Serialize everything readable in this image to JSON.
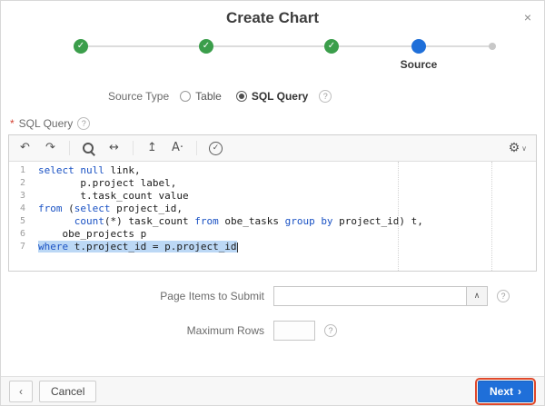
{
  "dialog": {
    "title": "Create Chart",
    "close_glyph": "×"
  },
  "stepper": {
    "check_glyph": "✓",
    "steps": [
      {
        "state": "complete"
      },
      {
        "state": "complete"
      },
      {
        "state": "complete"
      },
      {
        "state": "current",
        "label": "Source"
      },
      {
        "state": "pending"
      }
    ]
  },
  "source_type": {
    "label": "Source Type",
    "options": [
      {
        "label": "Table",
        "selected": false
      },
      {
        "label": "SQL Query",
        "selected": true
      }
    ]
  },
  "sql_editor": {
    "label": "SQL Query",
    "required_marker": "*",
    "toolbar": {
      "icons": [
        {
          "name": "undo-icon",
          "glyph": "↶"
        },
        {
          "name": "redo-icon",
          "glyph": "↷"
        },
        {
          "name": "search-icon",
          "glyph": ""
        },
        {
          "name": "find-replace-icon",
          "glyph": "↔"
        },
        {
          "name": "autocomplete-icon",
          "glyph": "↥"
        },
        {
          "name": "font-size-icon",
          "glyph": "A·"
        },
        {
          "name": "validate-icon",
          "glyph": "✓"
        }
      ],
      "settings_glyph": "⚙",
      "settings_chevron": "∨"
    },
    "lines": [
      {
        "num": 1,
        "selected": false,
        "tokens": [
          {
            "t": "kw",
            "v": "select"
          },
          {
            "t": "pl",
            "v": " "
          },
          {
            "t": "kw",
            "v": "null"
          },
          {
            "t": "pl",
            "v": " link,"
          }
        ]
      },
      {
        "num": 2,
        "selected": false,
        "tokens": [
          {
            "t": "pl",
            "v": "       p.project label,"
          }
        ]
      },
      {
        "num": 3,
        "selected": false,
        "tokens": [
          {
            "t": "pl",
            "v": "       t.task_count value"
          }
        ]
      },
      {
        "num": 4,
        "selected": false,
        "tokens": [
          {
            "t": "kw",
            "v": "from"
          },
          {
            "t": "pl",
            "v": " ("
          },
          {
            "t": "kw",
            "v": "select"
          },
          {
            "t": "pl",
            "v": " project_id,"
          }
        ]
      },
      {
        "num": 5,
        "selected": false,
        "tokens": [
          {
            "t": "pl",
            "v": "      "
          },
          {
            "t": "kw",
            "v": "count"
          },
          {
            "t": "pl",
            "v": "(*) task_count "
          },
          {
            "t": "kw",
            "v": "from"
          },
          {
            "t": "pl",
            "v": " obe_tasks "
          },
          {
            "t": "kw",
            "v": "group by"
          },
          {
            "t": "pl",
            "v": " project_id) t,"
          }
        ]
      },
      {
        "num": 6,
        "selected": false,
        "tokens": [
          {
            "t": "pl",
            "v": "    obe_projects p"
          }
        ]
      },
      {
        "num": 7,
        "selected": true,
        "tokens": [
          {
            "t": "kw",
            "v": "where"
          },
          {
            "t": "pl",
            "v": " t.project_id = p.project_id"
          }
        ]
      }
    ]
  },
  "form": {
    "page_items": {
      "label": "Page Items to Submit",
      "value": "",
      "combo_glyph": "∧"
    },
    "max_rows": {
      "label": "Maximum Rows",
      "value": ""
    }
  },
  "footer": {
    "prev_glyph": "‹",
    "cancel_label": "Cancel",
    "next_label": "Next",
    "next_chevron": "›"
  },
  "help_glyph": "?",
  "colors": {
    "accent_blue": "#1f6fd9",
    "success_green": "#3b9e4b",
    "keyword_blue": "#1a52c4",
    "selection_blue": "#bcd8f5",
    "focus_ring_red": "#e0482a"
  }
}
